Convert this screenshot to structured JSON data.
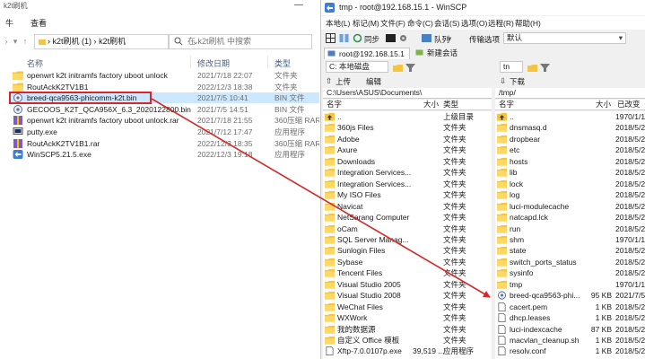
{
  "explorer": {
    "title": "k2t刷机",
    "menu": {
      "view": "查看",
      "file_partial": "牛"
    },
    "address": {
      "segment1": "k2t刷机 (1)",
      "segment2": "k2t刷机",
      "sep": "›"
    },
    "search_placeholder": "在 k2t刷机 中搜索",
    "columns": {
      "name": "名称",
      "date": "修改日期",
      "type": "类型"
    },
    "files": [
      {
        "name": "openwrt k2t initramfs factory uboot unlock",
        "date": "2021/7/18 22:07",
        "type": "文件夹",
        "icon": "folder-icon"
      },
      {
        "name": "RoutAckK2TV1B1",
        "date": "2022/12/3 18:38",
        "type": "文件夹",
        "icon": "folder-icon"
      },
      {
        "name": "breed-qca9563-phicomm-k2t.bin",
        "date": "2021/7/5 10:41",
        "type": "BIN 文件",
        "icon": "bin-file-icon"
      },
      {
        "name": "GECOOS_K2T_QCA956X_6.3_2020122800.bin",
        "date": "2021/7/5 14:51",
        "type": "BIN 文件",
        "icon": "bin-file-icon"
      },
      {
        "name": "openwrt k2t initramfs factory uboot unlock.rar",
        "date": "2021/7/18 21:55",
        "type": "360压缩 RAR 文件",
        "icon": "archive-icon"
      },
      {
        "name": "putty.exe",
        "date": "2021/7/12 17:47",
        "type": "应用程序",
        "icon": "putty-icon"
      },
      {
        "name": "RoutAckK2TV1B1.rar",
        "date": "2022/12/3 18:35",
        "type": "360压缩 RAR 文件",
        "icon": "archive-icon"
      },
      {
        "name": "WinSCP5.21.5.exe",
        "date": "2022/12/3 19:18",
        "type": "应用程序",
        "icon": "winscp-icon"
      }
    ]
  },
  "winscp": {
    "title": "tmp - root@192.168.15.1 - WinSCP",
    "menu": [
      "本地(L)",
      "标记(M)",
      "文件(F)",
      "命令(C)",
      "会话(S)",
      "选项(O)",
      "远程(R)",
      "帮助(H)"
    ],
    "toolbar": {
      "sync": "同步",
      "queue": "队列",
      "transfer_options": "传输选项",
      "transfer_default": "默认"
    },
    "tabs": {
      "session": "root@192.168.15.1",
      "new_session": "新建会话"
    },
    "local_path_toolbar": {
      "drive": "C: 本地磁盘",
      "upload": "上传",
      "edit": "编辑"
    },
    "remote_path_toolbar": {
      "dir": "tn",
      "download": "下载"
    },
    "local": {
      "path": "C:\\Users\\ASUS\\Documents\\",
      "columns": {
        "name": "名字",
        "size": "大小",
        "type": "类型"
      },
      "files": [
        {
          "name": "..",
          "size": "",
          "type": "上级目录"
        },
        {
          "name": "360js Files",
          "size": "",
          "type": "文件夹"
        },
        {
          "name": "Adobe",
          "size": "",
          "type": "文件夹"
        },
        {
          "name": "Axure",
          "size": "",
          "type": "文件夹"
        },
        {
          "name": "Downloads",
          "size": "",
          "type": "文件夹"
        },
        {
          "name": "Integration Services...",
          "size": "",
          "type": "文件夹"
        },
        {
          "name": "Integration Services...",
          "size": "",
          "type": "文件夹"
        },
        {
          "name": "My ISO Files",
          "size": "",
          "type": "文件夹"
        },
        {
          "name": "Navicat",
          "size": "",
          "type": "文件夹"
        },
        {
          "name": "NetSarang Computer",
          "size": "",
          "type": "文件夹"
        },
        {
          "name": "oCam",
          "size": "",
          "type": "文件夹"
        },
        {
          "name": "SQL Server Manag...",
          "size": "",
          "type": "文件夹"
        },
        {
          "name": "Sunlogin Files",
          "size": "",
          "type": "文件夹"
        },
        {
          "name": "Sybase",
          "size": "",
          "type": "文件夹"
        },
        {
          "name": "Tencent Files",
          "size": "",
          "type": "文件夹"
        },
        {
          "name": "Visual Studio 2005",
          "size": "",
          "type": "文件夹"
        },
        {
          "name": "Visual Studio 2008",
          "size": "",
          "type": "文件夹"
        },
        {
          "name": "WeChat Files",
          "size": "",
          "type": "文件夹"
        },
        {
          "name": "WXWork",
          "size": "",
          "type": "文件夹"
        },
        {
          "name": "我的数据源",
          "size": "",
          "type": "文件夹"
        },
        {
          "name": "自定义 Office 模板",
          "size": "",
          "type": "文件夹"
        },
        {
          "name": "Xftp-7.0.0107p.exe",
          "size": "39,519 ...",
          "type": "应用程序"
        }
      ]
    },
    "remote": {
      "path": "/tmp/",
      "columns": {
        "name": "名字",
        "size": "大小",
        "date": "已改变"
      },
      "files": [
        {
          "name": "..",
          "size": "",
          "date": "1970/1/1",
          "kind": "up"
        },
        {
          "name": "dnsmasq.d",
          "size": "",
          "date": "2018/5/2",
          "kind": "dir"
        },
        {
          "name": "dropbear",
          "size": "",
          "date": "2018/5/2",
          "kind": "dir"
        },
        {
          "name": "etc",
          "size": "",
          "date": "2018/5/2",
          "kind": "dir"
        },
        {
          "name": "hosts",
          "size": "",
          "date": "2018/5/2",
          "kind": "dir"
        },
        {
          "name": "lib",
          "size": "",
          "date": "2018/5/2",
          "kind": "dir"
        },
        {
          "name": "lock",
          "size": "",
          "date": "2018/5/2",
          "kind": "dir"
        },
        {
          "name": "log",
          "size": "",
          "date": "2018/5/2",
          "kind": "dir"
        },
        {
          "name": "luci-modulecache",
          "size": "",
          "date": "2018/5/2",
          "kind": "dir"
        },
        {
          "name": "natcapd.lck",
          "size": "",
          "date": "2018/5/2",
          "kind": "dir"
        },
        {
          "name": "run",
          "size": "",
          "date": "2018/5/2",
          "kind": "dir"
        },
        {
          "name": "shm",
          "size": "",
          "date": "1970/1/1",
          "kind": "dir"
        },
        {
          "name": "state",
          "size": "",
          "date": "2018/5/2",
          "kind": "dir"
        },
        {
          "name": "switch_ports_status",
          "size": "",
          "date": "2018/5/2",
          "kind": "dir"
        },
        {
          "name": "sysinfo",
          "size": "",
          "date": "2018/5/2",
          "kind": "dir"
        },
        {
          "name": "tmp",
          "size": "",
          "date": "1970/1/1",
          "kind": "dir"
        },
        {
          "name": "breed-qca9563-phi...",
          "size": "95 KB",
          "date": "2021/7/5",
          "kind": "bin"
        },
        {
          "name": "cacert.pem",
          "size": "1 KB",
          "date": "2018/5/2",
          "kind": "file"
        },
        {
          "name": "dhcp.leases",
          "size": "1 KB",
          "date": "2018/5/2",
          "kind": "file"
        },
        {
          "name": "luci-indexcache",
          "size": "87 KB",
          "date": "2018/5/2",
          "kind": "file"
        },
        {
          "name": "macvlan_cleanup.sh",
          "size": "1 KB",
          "date": "2018/5/2",
          "kind": "file"
        },
        {
          "name": "resolv.conf",
          "size": "1 KB",
          "date": "2018/5/2",
          "kind": "file"
        }
      ]
    }
  },
  "colors": {
    "annotation_red": "#d62828",
    "folder": "#f5c542",
    "selection": "#cce8ff"
  }
}
